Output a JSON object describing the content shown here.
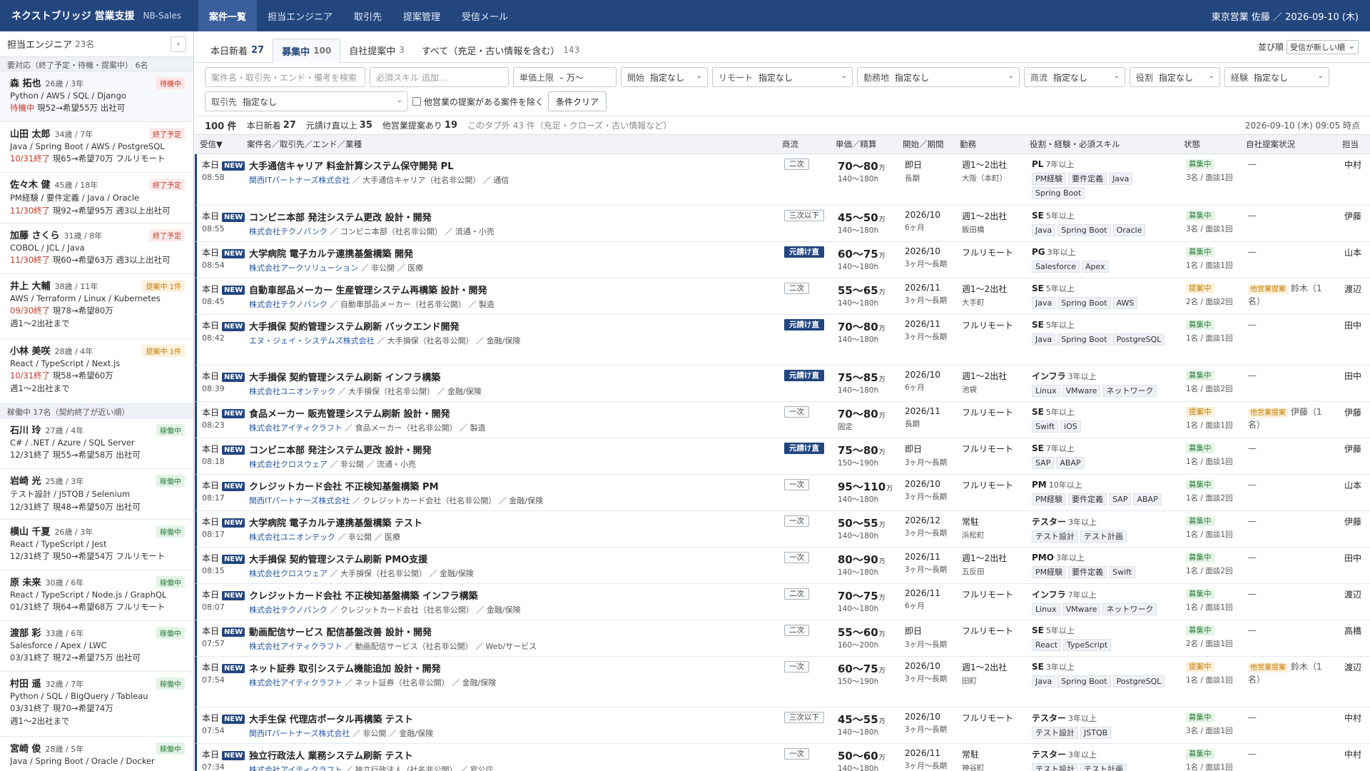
{
  "header": {
    "brand": "ネクストブリッジ 営業支援",
    "brand_sub": "NB-Sales",
    "user": "東京営業 佐藤 ／ 2026-09-10 (木)",
    "nav": [
      "案件一覧",
      "担当エンジニア",
      "取引先",
      "提案管理",
      "受信メール"
    ]
  },
  "sidebar": {
    "title": "担当エンジニア",
    "count": "23名",
    "collapse": "‹",
    "group1": "要対応（終了予定・待機・提案中） 6名",
    "group2": "稼働中 17名（契約終了が近い順）",
    "engineers": [
      {
        "name": "森 拓也",
        "age": "26歳 / 3年",
        "badge": "待機中",
        "badge_type": "wait",
        "skills": "Python / AWS / SQL / Django",
        "meta_red": "待機中",
        "meta": " 現52→希望55万  出社可",
        "extra": ""
      },
      {
        "name": "山田 太郎",
        "age": "34歳 / 7年",
        "badge": "終了予定",
        "badge_type": "end",
        "skills": "Java / Spring Boot / AWS / PostgreSQL",
        "meta_red": "10/31終了",
        "meta": " 現65→希望70万  フルリモート",
        "extra": ""
      },
      {
        "name": "佐々木 健",
        "age": "45歳 / 18年",
        "badge": "終了予定",
        "badge_type": "end",
        "skills": "PM経験 / 要件定義 / Java / Oracle",
        "meta_red": "11/30終了",
        "meta": " 現92→希望95万  週3以上出社可",
        "extra": ""
      },
      {
        "name": "加藤 さくら",
        "age": "31歳 / 8年",
        "badge": "終了予定",
        "badge_type": "end",
        "skills": "COBOL / JCL / Java",
        "meta_red": "11/30終了",
        "meta": " 現60→希望63万  週3以上出社可",
        "extra": ""
      },
      {
        "name": "井上 大輔",
        "age": "38歳 / 11年",
        "badge": "提案中 1件",
        "badge_type": "prop",
        "skills": "AWS / Terraform / Linux / Kubernetes",
        "meta_red": "09/30終了",
        "meta": " 現78→希望80万",
        "extra": "週1〜2出社まで"
      },
      {
        "name": "小林 美咲",
        "age": "28歳 / 4年",
        "badge": "提案中 1件",
        "badge_type": "prop",
        "skills": "React / TypeScript / Next.js",
        "meta_red": "10/31終了",
        "meta": " 現58→希望60万",
        "extra": "週1〜2出社まで"
      },
      {
        "name": "石川 玲",
        "age": "27歳 / 4年",
        "badge": "稼働中",
        "badge_type": "run",
        "skills": "C# / .NET / Azure / SQL Server",
        "meta_red": "",
        "meta": "12/31終了 現55→希望58万  出社可",
        "extra": ""
      },
      {
        "name": "岩崎 光",
        "age": "25歳 / 3年",
        "badge": "稼働中",
        "badge_type": "run",
        "skills": "テスト設計 / JSTQB / Selenium",
        "meta_red": "",
        "meta": "12/31終了 現48→希望50万  出社可",
        "extra": ""
      },
      {
        "name": "横山 千夏",
        "age": "26歳 / 3年",
        "badge": "稼働中",
        "badge_type": "run",
        "skills": "React / TypeScript / Jest",
        "meta_red": "",
        "meta": "12/31終了 現50→希望54万  フルリモート",
        "extra": ""
      },
      {
        "name": "原 未来",
        "age": "30歳 / 6年",
        "badge": "稼働中",
        "badge_type": "run",
        "skills": "React / TypeScript / Node.js / GraphQL",
        "meta_red": "",
        "meta": "01/31終了 現64→希望68万  フルリモート",
        "extra": ""
      },
      {
        "name": "渡部 彩",
        "age": "33歳 / 6年",
        "badge": "稼働中",
        "badge_type": "run",
        "skills": "Salesforce / Apex / LWC",
        "meta_red": "",
        "meta": "03/31終了 現72→希望75万  出社可",
        "extra": ""
      },
      {
        "name": "村田 遥",
        "age": "32歳 / 7年",
        "badge": "稼働中",
        "badge_type": "run",
        "skills": "Python / SQL / BigQuery / Tableau",
        "meta_red": "",
        "meta": "03/31終了 現70→希望74万",
        "extra": "週1〜2出社まで"
      },
      {
        "name": "宮崎 俊",
        "age": "28歳 / 5年",
        "badge": "稼働中",
        "badge_type": "run",
        "skills": "Java / Spring Boot / Oracle / Docker",
        "meta_red": "",
        "meta": "",
        "extra": ""
      }
    ]
  },
  "tabs": [
    {
      "label": "本日新着",
      "n": "27"
    },
    {
      "label": "募集中",
      "n": "100"
    },
    {
      "label": "自社提案中",
      "n": "3"
    },
    {
      "label": "すべて（充足・古い情報を含む）",
      "n": "143"
    }
  ],
  "sort": {
    "label": "並び順",
    "value": "受信が新しい順"
  },
  "filters": {
    "keyword": "案件名・取引先・エンド・備考を検索",
    "skill": "必須スキル  追加…",
    "price_label": "単価上限",
    "price_unit": "–    万〜",
    "start_label": "開始",
    "remote_label": "リモート",
    "area_label": "勤務地",
    "flow_label": "商流",
    "role_label": "役割",
    "exp_label": "経験",
    "client_label": "取引先",
    "none": "指定なし",
    "exclude": "他営業の提案がある案件を除く",
    "clear": "条件クリア"
  },
  "summary": {
    "total_n": "100 件",
    "new_label": "本日新着",
    "new_n": "27",
    "direct_label": "元請け直以上",
    "direct_n": "35",
    "other_label": "他営業提案あり",
    "other_n": "19",
    "hidden": "このタブ外 43 件（充足・クローズ・古い情報など）",
    "timestamp": "2026-09-10 (木) 09:05 時点"
  },
  "columns": [
    "受信▼",
    "案件名／取引先／エンド／業種",
    "商流",
    "単価／精算",
    "開始／期間",
    "勤務",
    "役割・経験・必須スキル",
    "状態",
    "自社提案状況",
    "担当"
  ],
  "rows": [
    {
      "day": "本日",
      "time": "08:58",
      "title": "大手通信キャリア 料金計算システム保守開発 PL",
      "company": "関西ITパートナーズ株式会社",
      "end": "大手通信キャリア（社名非公開）",
      "industry": "通信",
      "flow": "二次",
      "direct": false,
      "price": "70〜80",
      "settle": "140〜180h",
      "start": "即日",
      "period": "長期",
      "work": "週1〜2出社",
      "place": "大阪（本町）",
      "role": "PL",
      "years": "7年以上",
      "tags": [
        "PM経験",
        "要件定義",
        "Java",
        "Spring Boot"
      ],
      "status": "募集中",
      "status_type": "recruit",
      "count": "3名 / 面談1回",
      "own": "—",
      "own_badge": "",
      "staff": "中村",
      "h": 72
    },
    {
      "day": "本日",
      "time": "08:55",
      "title": "コンビニ本部 発注システム更改 設計・開発",
      "company": "株式会社テクノバンク",
      "end": "コンビニ本部（社名非公開）",
      "industry": "流通・小売",
      "flow": "三次以下",
      "direct": false,
      "price": "45〜50",
      "settle": "140〜180h",
      "start": "2026/10",
      "period": "6ヶ月",
      "work": "週1〜2出社",
      "place": "飯田橋",
      "role": "SE",
      "years": "5年以上",
      "tags": [
        "Java",
        "Spring Boot",
        "Oracle"
      ],
      "status": "募集中",
      "status_type": "recruit",
      "count": "3名 / 面談1回",
      "own": "—",
      "own_badge": "",
      "staff": "伊藤",
      "h": 51
    },
    {
      "day": "本日",
      "time": "08:54",
      "title": "大学病院 電子カルテ連携基盤構築 開発",
      "company": "株式会社アークソリューション",
      "end": "非公開",
      "industry": "医療",
      "flow": "元請け直",
      "direct": true,
      "price": "60〜75",
      "settle": "140〜180h",
      "start": "2026/10",
      "period": "3ヶ月〜長期",
      "work": "フルリモート",
      "place": "",
      "role": "PG",
      "years": "3年以上",
      "tags": [
        "Salesforce",
        "Apex"
      ],
      "status": "募集中",
      "status_type": "recruit",
      "count": "1名 / 面談1回",
      "own": "—",
      "own_badge": "",
      "staff": "山本",
      "h": 51
    },
    {
      "day": "本日",
      "time": "08:45",
      "title": "自動車部品メーカー 生産管理システム再構築 設計・開発",
      "company": "株式会社テクノバンク",
      "end": "自動車部品メーカー（社名非公開）",
      "industry": "製造",
      "flow": "二次",
      "direct": false,
      "price": "55〜65",
      "settle": "140〜180h",
      "start": "2026/11",
      "period": "3ヶ月〜長期",
      "work": "週1〜2出社",
      "place": "大手町",
      "role": "SE",
      "years": "5年以上",
      "tags": [
        "Java",
        "Spring Boot",
        "AWS"
      ],
      "status": "提案中",
      "status_type": "proposing",
      "count": "2名 / 面談2回",
      "own": "鈴木（1名）",
      "own_badge": "他営業提案",
      "staff": "渡辺",
      "h": 51
    },
    {
      "day": "本日",
      "time": "08:42",
      "title": "大手損保 契約管理システム刷新 バックエンド開発",
      "company": "エヌ・ジェイ・システムズ株式会社",
      "end": "大手損保（社名非公開）",
      "industry": "金融/保険",
      "flow": "元請け直",
      "direct": true,
      "price": "70〜80",
      "settle": "140〜180h",
      "start": "2026/11",
      "period": "3ヶ月〜長期",
      "work": "フルリモート",
      "place": "",
      "role": "SE",
      "years": "5年以上",
      "tags": [
        "Java",
        "Spring Boot",
        "PostgreSQL"
      ],
      "status": "募集中",
      "status_type": "recruit",
      "count": "1名 / 面談1回",
      "own": "—",
      "own_badge": "",
      "staff": "田中",
      "h": 71
    },
    {
      "day": "本日",
      "time": "08:39",
      "title": "大手損保 契約管理システム刷新 インフラ構築",
      "company": "株式会社ユニオンテック",
      "end": "大手損保（社名非公開）",
      "industry": "金融/保険",
      "flow": "元請け直",
      "direct": true,
      "price": "75〜85",
      "settle": "140〜180h",
      "start": "2026/10",
      "period": "6ヶ月",
      "work": "週1〜2出社",
      "place": "池袋",
      "role": "インフラ",
      "years": "3年以上",
      "tags": [
        "Linux",
        "VMware",
        "ネットワーク"
      ],
      "status": "募集中",
      "status_type": "recruit",
      "count": "1名 / 面談2回",
      "own": "—",
      "own_badge": "",
      "staff": "田中",
      "h": 51
    },
    {
      "day": "本日",
      "time": "08:23",
      "title": "食品メーカー 販売管理システム刷新 設計・開発",
      "company": "株式会社アイティクラフト",
      "end": "食品メーカー（社名非公開）",
      "industry": "製造",
      "flow": "一次",
      "direct": false,
      "price": "70〜80",
      "settle": "固定",
      "start": "2026/11",
      "period": "長期",
      "work": "フルリモート",
      "place": "",
      "role": "SE",
      "years": "5年以上",
      "tags": [
        "Swift",
        "iOS"
      ],
      "status": "提案中",
      "status_type": "proposing",
      "count": "1名 / 面談1回",
      "own": "伊藤（1名）",
      "own_badge": "他営業提案",
      "staff": "伊藤",
      "h": 51
    },
    {
      "day": "本日",
      "time": "08:18",
      "title": "コンビニ本部 発注システム更改 設計・開発",
      "company": "株式会社クロスウェア",
      "end": "非公開",
      "industry": "流通・小売",
      "flow": "元請け直",
      "direct": true,
      "price": "75〜80",
      "settle": "150〜190h",
      "start": "即日",
      "period": "3ヶ月〜長期",
      "work": "フルリモート",
      "place": "",
      "role": "SE",
      "years": "7年以上",
      "tags": [
        "SAP",
        "ABAP"
      ],
      "status": "募集中",
      "status_type": "recruit",
      "count": "1名 / 面談1回",
      "own": "—",
      "own_badge": "",
      "staff": "伊藤",
      "h": 51
    },
    {
      "day": "本日",
      "time": "08:17",
      "title": "クレジットカード会社 不正検知基盤構築 PM",
      "company": "関西ITパートナーズ株式会社",
      "end": "クレジットカード会社（社名非公開）",
      "industry": "金融/保険",
      "flow": "一次",
      "direct": false,
      "price": "95〜110",
      "settle": "140〜180h",
      "start": "2026/10",
      "period": "3ヶ月〜長期",
      "work": "フルリモート",
      "place": "",
      "role": "PM",
      "years": "10年以上",
      "tags": [
        "PM経験",
        "要件定義",
        "SAP",
        "ABAP"
      ],
      "status": "募集中",
      "status_type": "recruit",
      "count": "1名 / 面談2回",
      "own": "—",
      "own_badge": "",
      "staff": "山本",
      "h": 51
    },
    {
      "day": "本日",
      "time": "08:17",
      "title": "大学病院 電子カルテ連携基盤構築 テスト",
      "company": "株式会社ユニオンテック",
      "end": "非公開",
      "industry": "医療",
      "flow": "一次",
      "direct": false,
      "price": "50〜55",
      "settle": "140〜180h",
      "start": "2026/12",
      "period": "3ヶ月〜長期",
      "work": "常駐",
      "place": "浜松町",
      "role": "テスター",
      "years": "3年以上",
      "tags": [
        "テスト設計",
        "テスト計画"
      ],
      "status": "募集中",
      "status_type": "recruit",
      "count": "1名 / 面談1回",
      "own": "—",
      "own_badge": "",
      "staff": "伊藤",
      "h": 51
    },
    {
      "day": "本日",
      "time": "08:15",
      "title": "大手損保 契約管理システム刷新 PMO支援",
      "company": "株式会社クロスウェア",
      "end": "大手損保（社名非公開）",
      "industry": "金融/保険",
      "flow": "一次",
      "direct": false,
      "price": "80〜90",
      "settle": "140〜180h",
      "start": "2026/11",
      "period": "3ヶ月〜長期",
      "work": "週1〜2出社",
      "place": "五反田",
      "role": "PMO",
      "years": "3年以上",
      "tags": [
        "PM経験",
        "要件定義",
        "Swift"
      ],
      "status": "募集中",
      "status_type": "recruit",
      "count": "1名 / 面談2回",
      "own": "—",
      "own_badge": "",
      "staff": "田中",
      "h": 51
    },
    {
      "day": "本日",
      "time": "08:07",
      "title": "クレジットカード会社 不正検知基盤構築 インフラ構築",
      "company": "株式会社テクノバンク",
      "end": "クレジットカード会社（社名非公開）",
      "industry": "金融/保険",
      "flow": "二次",
      "direct": false,
      "price": "70〜75",
      "settle": "140〜180h",
      "start": "2026/11",
      "period": "6ヶ月",
      "work": "フルリモート",
      "place": "",
      "role": "インフラ",
      "years": "7年以上",
      "tags": [
        "Linux",
        "VMware",
        "ネットワーク"
      ],
      "status": "募集中",
      "status_type": "recruit",
      "count": "1名 / 面談1回",
      "own": "—",
      "own_badge": "",
      "staff": "渡辺",
      "h": 51
    },
    {
      "day": "本日",
      "time": "07:57",
      "title": "動画配信サービス 配信基盤改善 設計・開発",
      "company": "株式会社アイティクラフト",
      "end": "動画配信サービス（社名非公開）",
      "industry": "Web/サービス",
      "flow": "二次",
      "direct": false,
      "price": "55〜60",
      "settle": "160〜200h",
      "start": "即日",
      "period": "3ヶ月〜長期",
      "work": "フルリモート",
      "place": "",
      "role": "SE",
      "years": "5年以上",
      "tags": [
        "React",
        "TypeScript"
      ],
      "status": "募集中",
      "status_type": "recruit",
      "count": "2名 / 面談1回",
      "own": "—",
      "own_badge": "",
      "staff": "高橋",
      "h": 51
    },
    {
      "day": "本日",
      "time": "07:54",
      "title": "ネット証券 取引システム機能追加 設計・開発",
      "company": "株式会社アイティクラフト",
      "end": "ネット証券（社名非公開）",
      "industry": "金融/保険",
      "flow": "一次",
      "direct": false,
      "price": "60〜75",
      "settle": "150〜190h",
      "start": "2026/10",
      "period": "3ヶ月〜長期",
      "work": "週1〜2出社",
      "place": "田町",
      "role": "SE",
      "years": "3年以上",
      "tags": [
        "Java",
        "Spring Boot",
        "PostgreSQL"
      ],
      "status": "提案中",
      "status_type": "proposing",
      "count": "1名 / 面談1回",
      "own": "鈴木（1名）",
      "own_badge": "他営業提案",
      "staff": "渡辺",
      "h": 71
    },
    {
      "day": "本日",
      "time": "07:54",
      "title": "大手生保 代理店ポータル再構築 テスト",
      "company": "関西ITパートナーズ株式会社",
      "end": "非公開",
      "industry": "金融/保険",
      "flow": "三次以下",
      "direct": false,
      "price": "45〜55",
      "settle": "140〜180h",
      "start": "2026/10",
      "period": "3ヶ月〜長期",
      "work": "フルリモート",
      "place": "",
      "role": "テスター",
      "years": "3年以上",
      "tags": [
        "テスト設計",
        "JSTQB"
      ],
      "status": "募集中",
      "status_type": "recruit",
      "count": "3名 / 面談1回",
      "own": "—",
      "own_badge": "",
      "staff": "中村",
      "h": 51
    },
    {
      "day": "本日",
      "time": "07:34",
      "title": "独立行政法人 業務システム刷新 テスト",
      "company": "株式会社アイティクラフト",
      "end": "独立行政法人（社名非公開）",
      "industry": "官公庁",
      "flow": "一次",
      "direct": false,
      "price": "50〜60",
      "settle": "140〜180h",
      "start": "2026/11",
      "period": "3ヶ月〜長期",
      "work": "常駐",
      "place": "神谷町",
      "role": "テスター",
      "years": "3年以上",
      "tags": [
        "テスト設計",
        "テスト計画"
      ],
      "status": "募集中",
      "status_type": "recruit",
      "count": "1名 / 面談1回",
      "own": "—",
      "own_badge": "",
      "staff": "中村",
      "h": 51
    }
  ]
}
